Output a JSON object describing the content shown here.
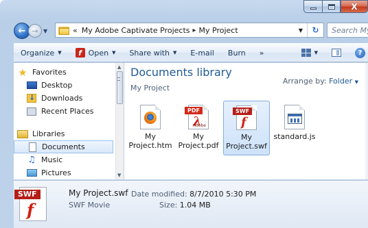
{
  "window": {
    "minimize_icon": "minimize-icon",
    "maximize_icon": "maximize-icon",
    "close_icon": "close-icon",
    "close_glyph": "X"
  },
  "address_bar": {
    "overflow": "«",
    "crumbs": [
      "My Adobe Captivate Projects",
      "My Project"
    ],
    "separator": "▸",
    "search_placeholder": "Search My ..."
  },
  "toolbar": {
    "organize": "Organize",
    "open": "Open",
    "share_with": "Share with",
    "email": "E-mail",
    "burn": "Burn",
    "more": "»"
  },
  "nav_pane": {
    "favorites": "Favorites",
    "desktop": "Desktop",
    "downloads": "Downloads",
    "recent_places": "Recent Places",
    "libraries": "Libraries",
    "documents": "Documents",
    "music": "Music",
    "pictures": "Pictures"
  },
  "content": {
    "title": "Documents library",
    "subtitle": "My Project",
    "arrange_label": "Arrange by:",
    "arrange_value": "Folder",
    "files": [
      {
        "name": "My Project.htm",
        "type": "htm",
        "icon": "firefox-icon"
      },
      {
        "name": "My Project.pdf",
        "type": "pdf",
        "icon": "pdf-icon",
        "tag": "PDF",
        "brand": "Adobe"
      },
      {
        "name": "My Project.swf",
        "type": "swf",
        "icon": "swf-icon",
        "tag": "SWF",
        "selected": true
      },
      {
        "name": "standard.js",
        "type": "js",
        "icon": "js-file-icon"
      }
    ]
  },
  "details": {
    "name": "My Project.swf",
    "type": "SWF Movie",
    "date_label": "Date modified:",
    "date_value": "8/7/2010 5:30 PM",
    "size_label": "Size:",
    "size_value": "1.04 MB",
    "tag": "SWF"
  }
}
